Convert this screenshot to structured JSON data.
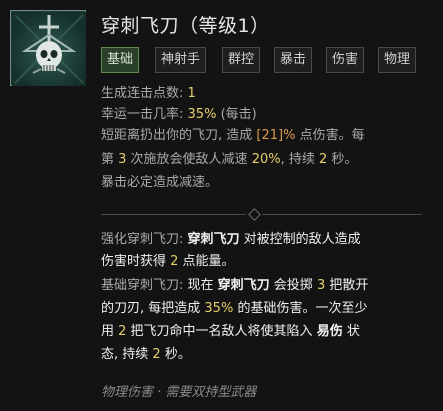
{
  "skill": {
    "name": "穿刺飞刀（等级1）",
    "icon": "skull-dagger-icon",
    "tags": [
      "基础",
      "神射手",
      "群控",
      "暴击",
      "伤害",
      "物理"
    ]
  },
  "stats": {
    "combo_label": "生成连击点数:",
    "combo_value": "1",
    "lucky_label": "幸运一击几率:",
    "lucky_value": "35%",
    "lucky_suffix": "(每击)"
  },
  "description": {
    "l1a": "短距离扔出你的飞刀, 造成 ",
    "l1b": "[21]%",
    "l1c": " 点伤害。每",
    "l2a": "第 ",
    "l2b": "3",
    "l2c": " 次施放会使敌人减速 ",
    "l2d": "20%",
    "l2e": ", 持续 ",
    "l2f": "2",
    "l2g": " 秒。",
    "l3": "暴击必定造成减速。"
  },
  "enhanced": {
    "label": "强化穿刺飞刀: ",
    "name": "穿刺飞刀",
    "t1": " 对被控制的敌人造成",
    "t2a": "伤害时获得 ",
    "t2b": "2",
    "t2c": " 点能量。"
  },
  "basic_upgrade": {
    "label": "基础穿刺飞刀: ",
    "t1a": "现在 ",
    "name": "穿刺飞刀",
    "t1b": " 会投掷 ",
    "t1c": "3",
    "t1d": " 把散开",
    "t2a": "的刀刃, 每把造成 ",
    "t2b": "35%",
    "t2c": " 的基础伤害。一次至少",
    "t3a": "用 ",
    "t3b": "2",
    "t3c": " 把飞刀命中一名敌人将使其陷入 ",
    "t3d": "易伤",
    "t3e": " 状",
    "t4a": "态, 持续 ",
    "t4b": "2",
    "t4c": " 秒。"
  },
  "footer": "物理伤害 · 需要双持型武器",
  "colors": {
    "highlight": "#e7cf6b",
    "bracket": "#d89c4d",
    "tag_primary": "#2a3f2a"
  }
}
